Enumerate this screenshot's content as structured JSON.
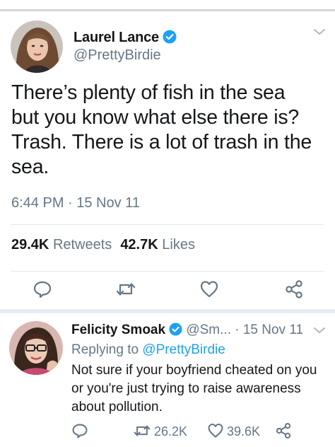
{
  "tweet": {
    "display_name": "Laurel Lance",
    "handle": "@PrettyBirdie",
    "text_lines": [
      "There’s plenty of fish in the sea",
      "but you know what else there is?",
      "Trash. There is a lot of trash in the",
      "sea."
    ],
    "timestamp": "6:44 PM · 15 Nov 11",
    "retweets_count": "29.4K",
    "retweets_label": "Retweets",
    "likes_count": "42.7K",
    "likes_label": "Likes"
  },
  "reply": {
    "display_name": "Felicity Smoak",
    "handle": "@Sm...",
    "date": "· 15 Nov 11",
    "replying_prefix": "Replying to",
    "replying_to": "@PrettyBirdie",
    "text_lines": [
      "Not sure if your boyfriend cheated on you",
      "or you're just trying to raise awareness",
      "about pollution."
    ],
    "retweets_count": "26.2K",
    "likes_count": "39.6K"
  },
  "icons": {
    "verified": "verified-badge-icon",
    "caret": "chevron-down-icon",
    "reply": "reply-icon",
    "retweet": "retweet-icon",
    "like": "heart-icon",
    "share": "share-icon"
  },
  "colors": {
    "accent": "#1da1f2",
    "secondary_text": "#657786",
    "primary_text": "#14171a"
  }
}
